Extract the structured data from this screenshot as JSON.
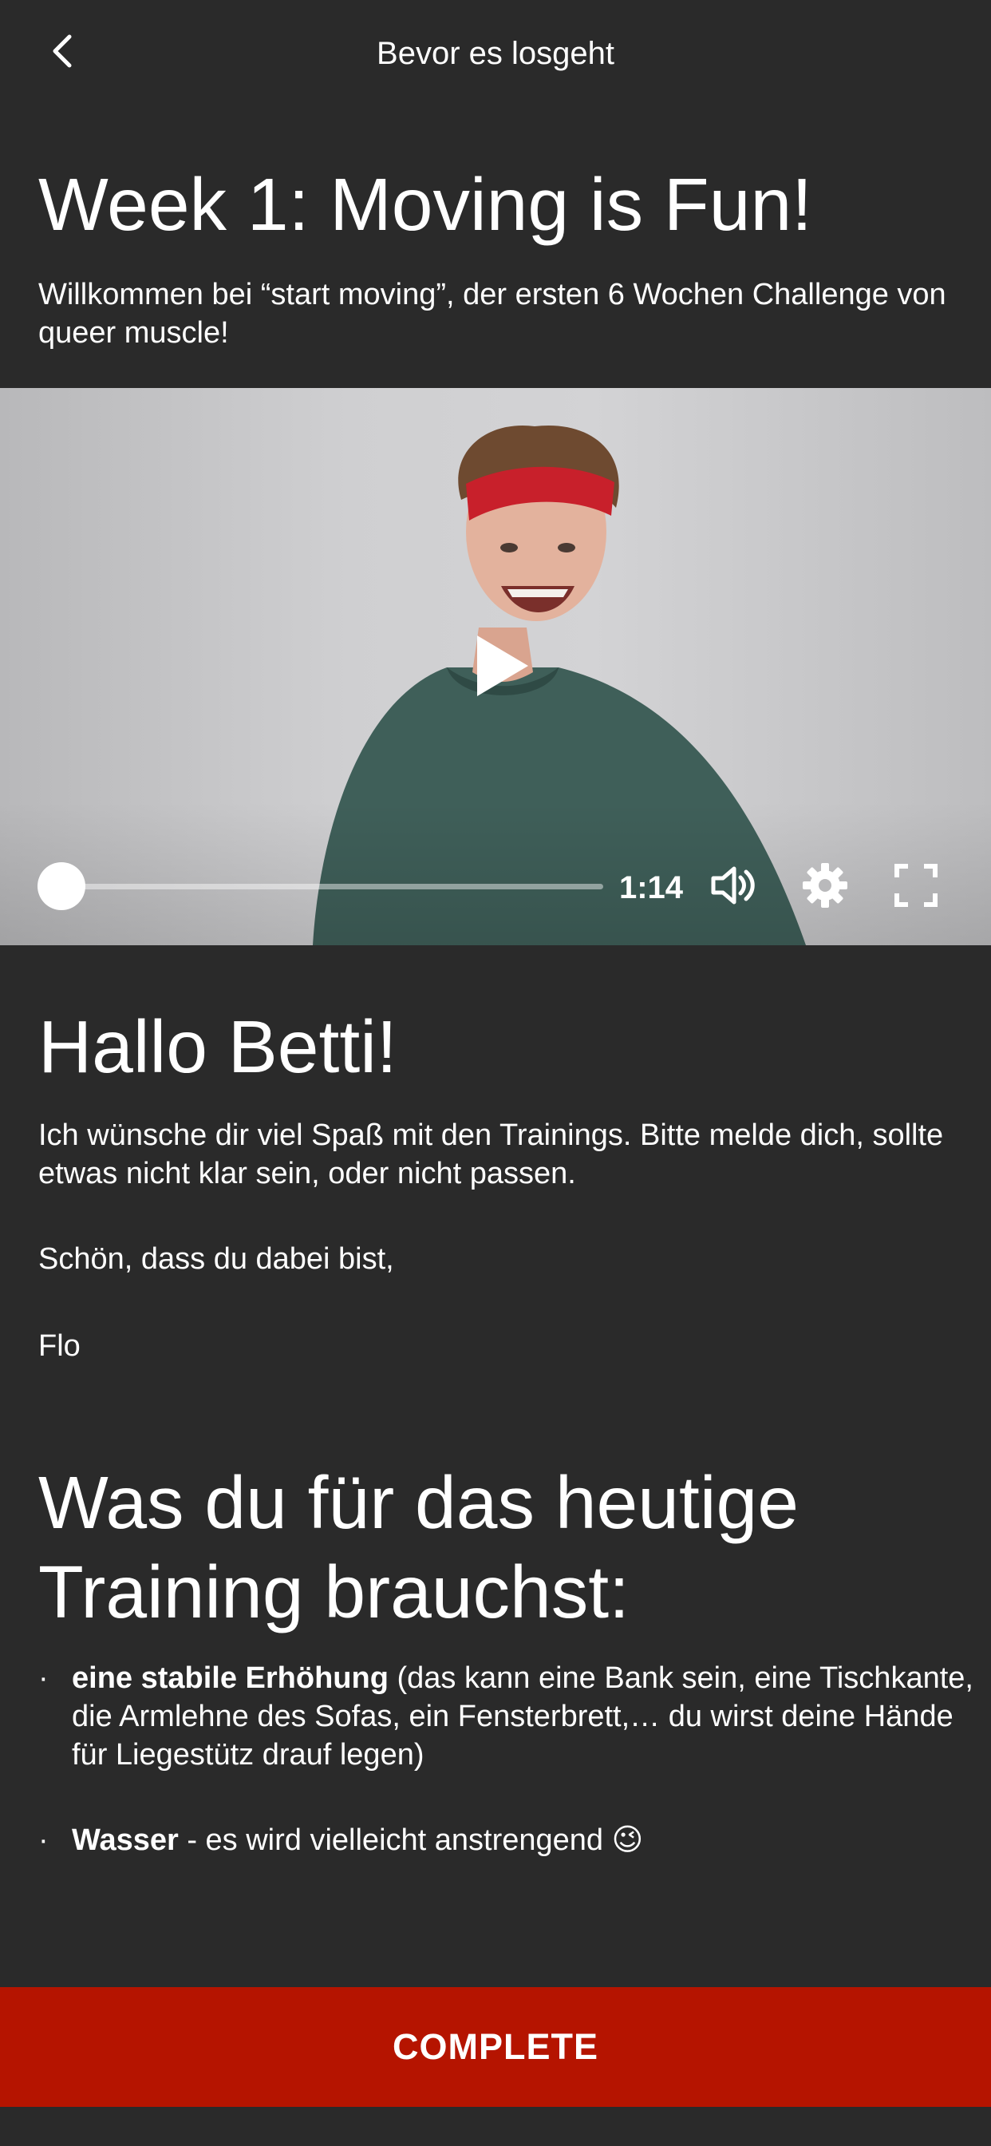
{
  "header": {
    "title": "Bevor es losgeht"
  },
  "week": {
    "title": "Week 1: Moving is Fun!",
    "intro": "Willkommen bei “start moving”, der ersten 6 Wochen Challenge von queer muscle!"
  },
  "video": {
    "duration": "1:14",
    "progress_fraction": 0.0
  },
  "welcome": {
    "heading": "Hallo Betti!",
    "message": "Ich wünsche dir viel Spaß mit den Trainings. Bitte melde dich, sollte etwas nicht klar sein, oder nicht passen.",
    "closing": "Schön, dass du dabei bist,",
    "signature": "Flo"
  },
  "equipment": {
    "heading": "Was du für das heutige Training brauchst:",
    "items": [
      {
        "bullet": "·",
        "bold": "eine stabile Erhöhung",
        "text": " (das kann eine Bank sein, eine Tischkante, die Armlehne des Sofas, ein Fensterbrett,… du wirst deine Hände für Liegestütz drauf legen)"
      },
      {
        "bullet": "·",
        "bold": "Wasser",
        "text": " - es wird vielleicht anstrengend 😉"
      }
    ]
  },
  "footer": {
    "button_label": "COMPLETE"
  }
}
